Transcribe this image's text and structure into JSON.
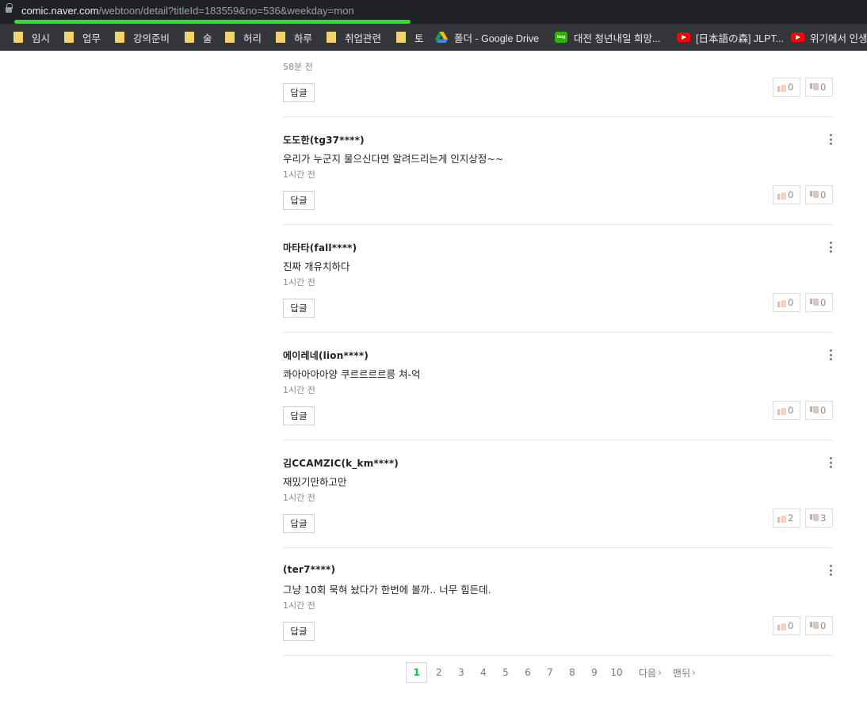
{
  "browser": {
    "url_host": "comic.naver.com",
    "url_path": "/webtoon/detail?titleId=183559&no=536&weekday=mon"
  },
  "bookmarks": [
    {
      "label": "임시",
      "icon": "folder-icon"
    },
    {
      "label": "업무",
      "icon": "folder-icon"
    },
    {
      "label": "강의준비",
      "icon": "folder-icon"
    },
    {
      "label": "술",
      "icon": "folder-icon"
    },
    {
      "label": "허리",
      "icon": "folder-icon"
    },
    {
      "label": "하루",
      "icon": "folder-icon"
    },
    {
      "label": "취업관련",
      "icon": "folder-icon"
    },
    {
      "label": "토",
      "icon": "folder-icon"
    },
    {
      "label": "폴더 - Google Drive",
      "icon": "google-drive-icon"
    },
    {
      "label": "대전 청년내일 희망...",
      "icon": "naver-blog-icon",
      "icon_text": "blog"
    },
    {
      "label": "[日本語の森] JLPT...",
      "icon": "youtube-icon"
    },
    {
      "label": "위기에서 인생",
      "icon": "youtube-icon"
    }
  ],
  "comments": {
    "reply_label": "답글",
    "partial": {
      "time": "58분 전",
      "up": "0",
      "down": "0"
    },
    "items": [
      {
        "author": "도도한(tg37****)",
        "text": "우리가 누군지 물으신다면 알려드리는게 인지상정~~",
        "time": "1시간 전",
        "up": "0",
        "down": "0"
      },
      {
        "author": "마타타(fall****)",
        "text": "진짜 개유치하다",
        "time": "1시간 전",
        "up": "0",
        "down": "0"
      },
      {
        "author": "에이레네(lion****)",
        "text": "콰아아아아양 쿠르르르르릉 쳐-억",
        "time": "1시간 전",
        "up": "0",
        "down": "0"
      },
      {
        "author": "김CCAMZIC(k_km****)",
        "text": "재밌기만하고만",
        "time": "1시간 전",
        "up": "2",
        "down": "3"
      },
      {
        "author": "(ter7****)",
        "text": "그냥 10회 묵혀 놨다가 한번에 볼까.. 너무 힘든데.",
        "time": "1시간 전",
        "up": "0",
        "down": "0"
      }
    ]
  },
  "pagination": {
    "pages": [
      "1",
      "2",
      "3",
      "4",
      "5",
      "6",
      "7",
      "8",
      "9",
      "10"
    ],
    "current": "1",
    "next_label": "다음",
    "last_label": "맨뒤"
  },
  "colors": {
    "accent_green": "#00c73c",
    "url_highlight": "#2ee02e"
  }
}
